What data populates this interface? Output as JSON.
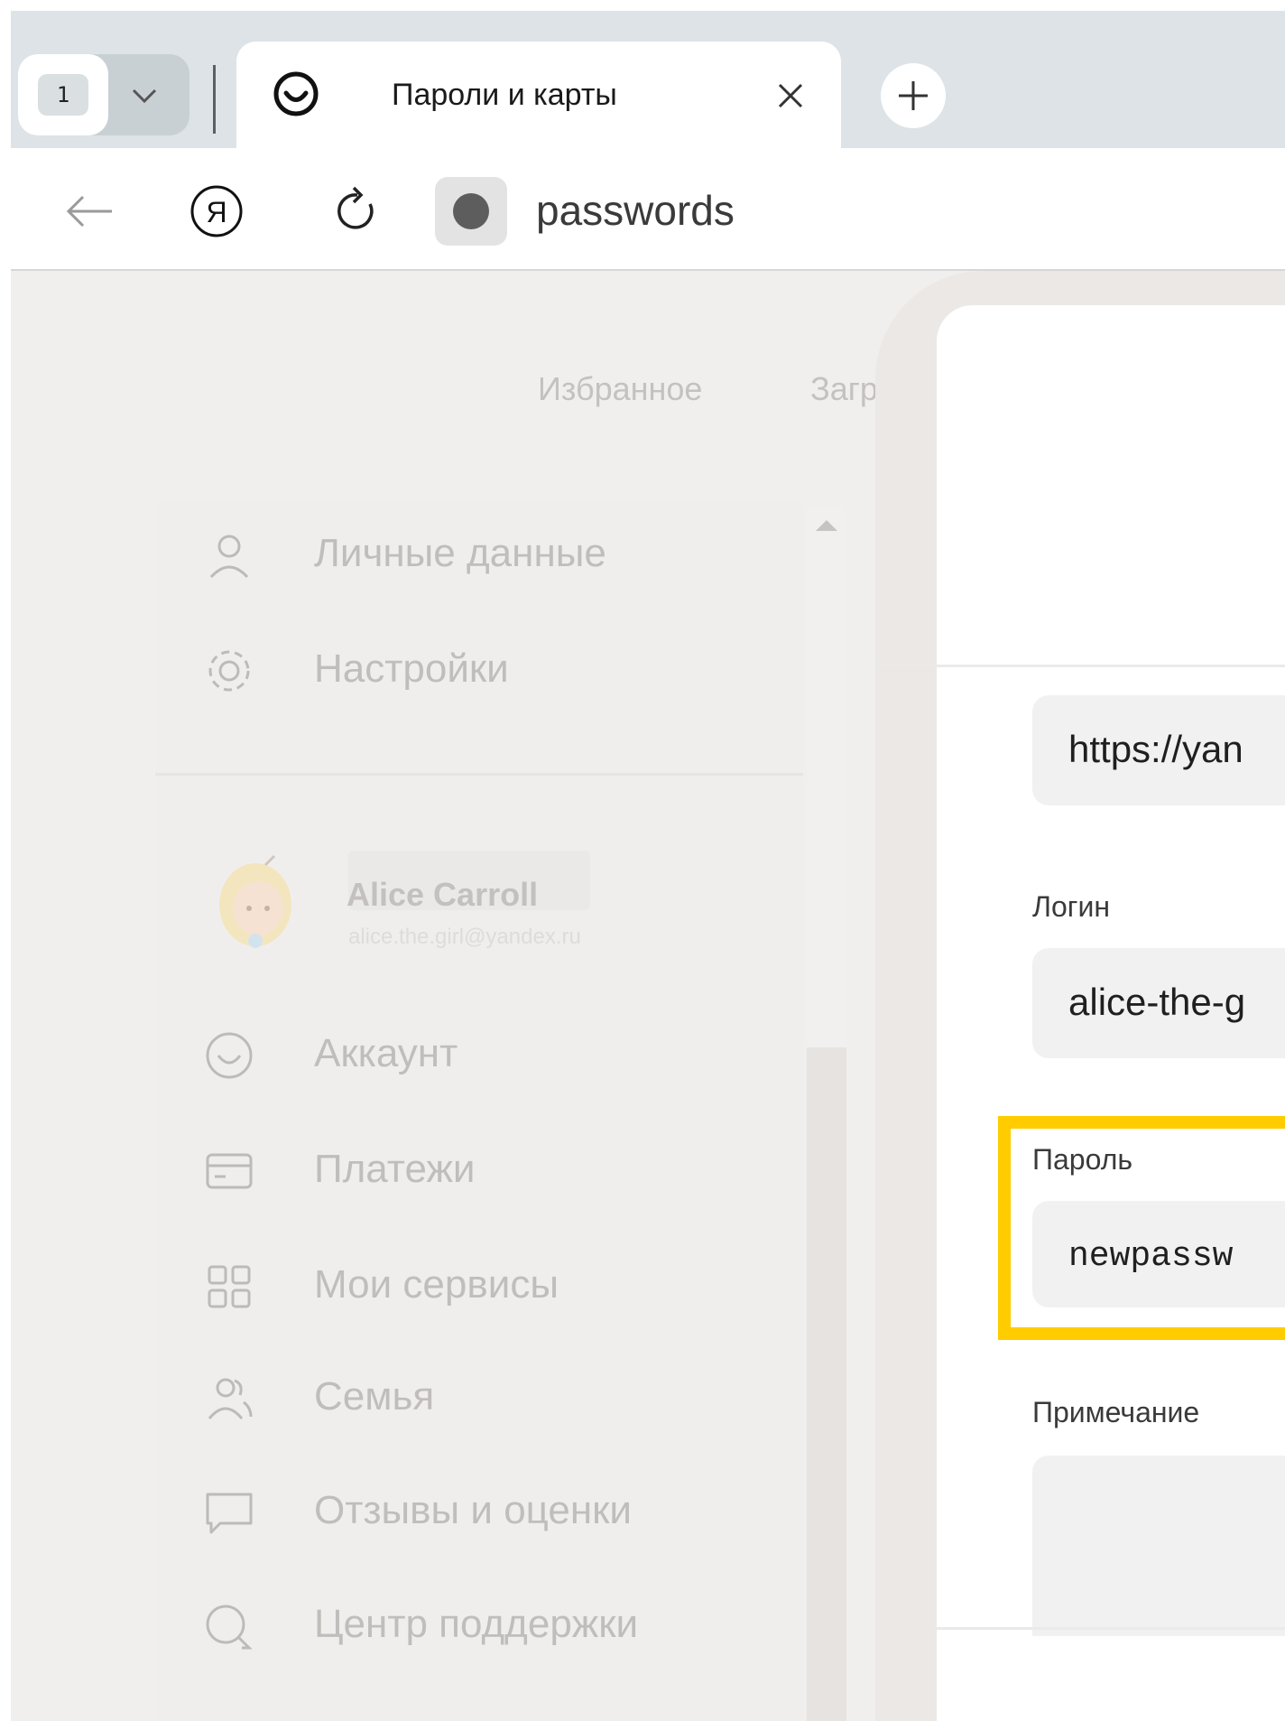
{
  "browser": {
    "tab_count": "1",
    "active_tab_title": "Пароли и карты",
    "address": "passwords"
  },
  "page": {
    "top_nav": [
      "Избранное",
      "Загрузк"
    ],
    "sidebar_top": [
      {
        "label": "Личные данные",
        "icon": "person-icon"
      },
      {
        "label": "Настройки",
        "icon": "gear-icon"
      }
    ],
    "user": {
      "name": "Alice Carroll",
      "email": "alice.the.girl@yandex.ru"
    },
    "sidebar_menu": [
      {
        "label": "Аккаунт",
        "icon": "account-icon"
      },
      {
        "label": "Платежи",
        "icon": "card-icon"
      },
      {
        "label": "Мои сервисы",
        "icon": "services-grid-icon"
      },
      {
        "label": "Семья",
        "icon": "family-icon"
      },
      {
        "label": "Отзывы и оценки",
        "icon": "reviews-icon"
      },
      {
        "label": "Центр поддержки",
        "icon": "support-icon"
      }
    ]
  },
  "modal": {
    "site_value": "https://yan",
    "login_label": "Логин",
    "login_value": "alice-the-g",
    "password_label": "Пароль",
    "password_value": "newpassw",
    "note_label": "Примечание"
  },
  "colors": {
    "highlight": "#ffcc00",
    "tabstrip": "#dde3e6",
    "dim_background": "#f1efee"
  }
}
